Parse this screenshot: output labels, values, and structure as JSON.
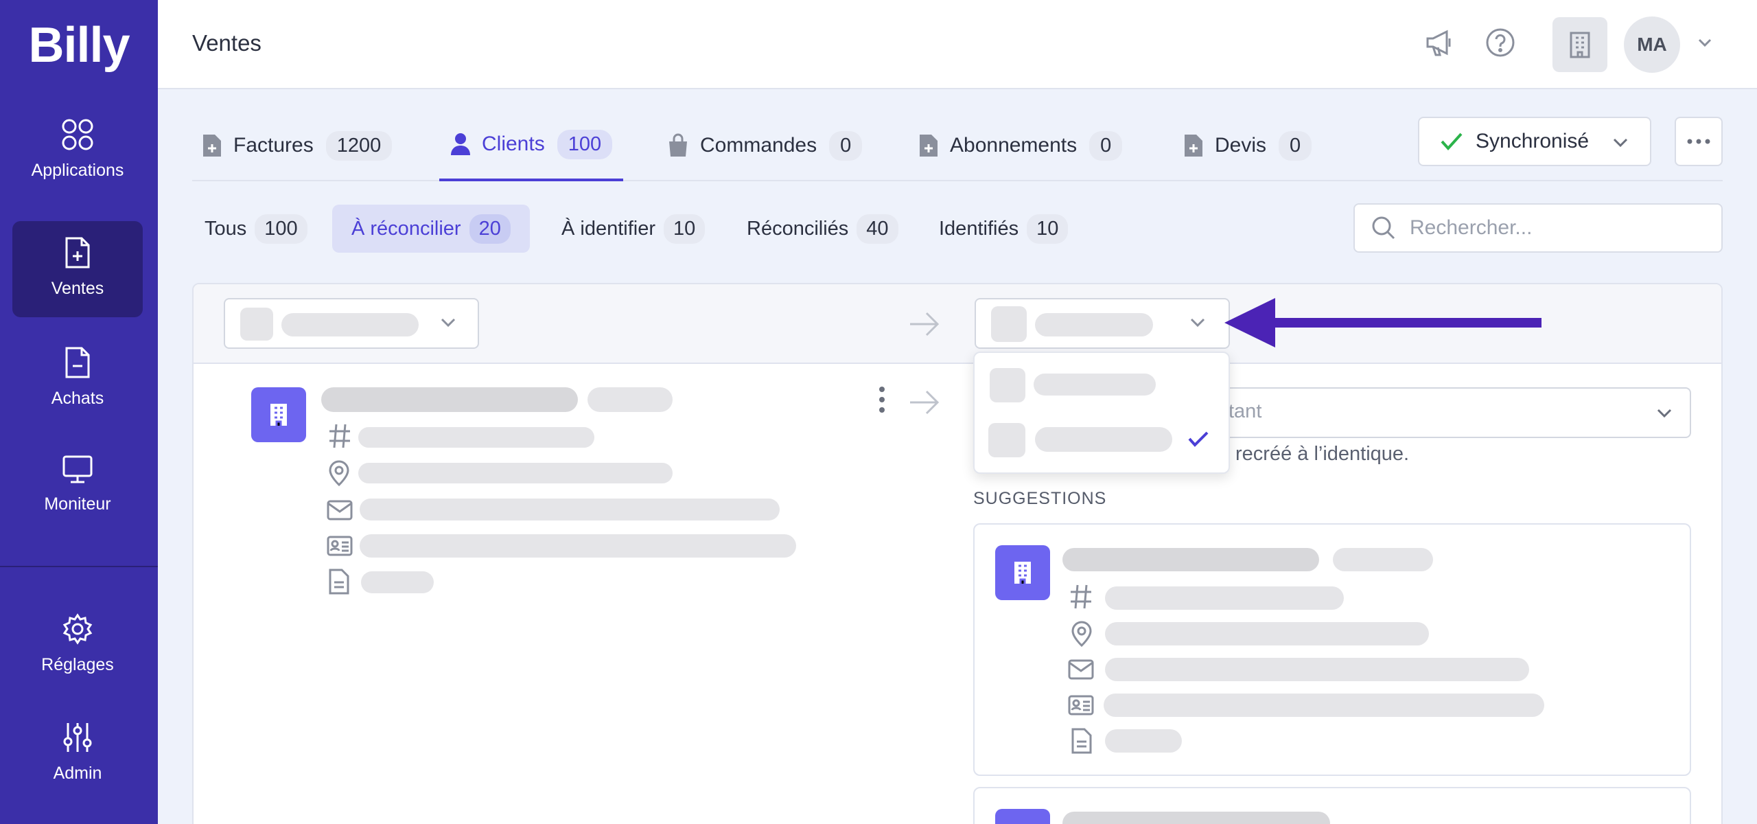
{
  "app": {
    "logo": "Billy"
  },
  "sidebar": {
    "items": [
      {
        "label": "Applications",
        "icon": "apps-icon"
      },
      {
        "label": "Ventes",
        "icon": "document-plus-icon",
        "active": true
      },
      {
        "label": "Achats",
        "icon": "document-minus-icon"
      },
      {
        "label": "Moniteur",
        "icon": "monitor-icon"
      },
      {
        "label": "Réglages",
        "icon": "gear-icon"
      },
      {
        "label": "Admin",
        "icon": "sliders-icon"
      }
    ]
  },
  "header": {
    "title": "Ventes",
    "avatar_initials": "MA"
  },
  "tabs": [
    {
      "label": "Factures",
      "count": "1200"
    },
    {
      "label": "Clients",
      "count": "100",
      "active": true
    },
    {
      "label": "Commandes",
      "count": "0"
    },
    {
      "label": "Abonnements",
      "count": "0"
    },
    {
      "label": "Devis",
      "count": "0"
    }
  ],
  "sync": {
    "label": "Synchronisé",
    "status_color": "#2bb34a"
  },
  "subtabs": [
    {
      "label": "Tous",
      "count": "100"
    },
    {
      "label": "À réconcilier",
      "count": "20",
      "active": true
    },
    {
      "label": "À identifier",
      "count": "10"
    },
    {
      "label": "Réconciliés",
      "count": "40"
    },
    {
      "label": "Identifiés",
      "count": "10"
    }
  ],
  "search": {
    "placeholder": "Rechercher..."
  },
  "panel": {
    "select_placeholder_tail": "tant",
    "hint_tail": "recréé à l’identique.",
    "suggestions_label": "SUGGESTIONS"
  },
  "colors": {
    "sidebar": "#3b2fa8",
    "accent": "#4b3fd6",
    "annotation_arrow": "#4b23b5"
  }
}
